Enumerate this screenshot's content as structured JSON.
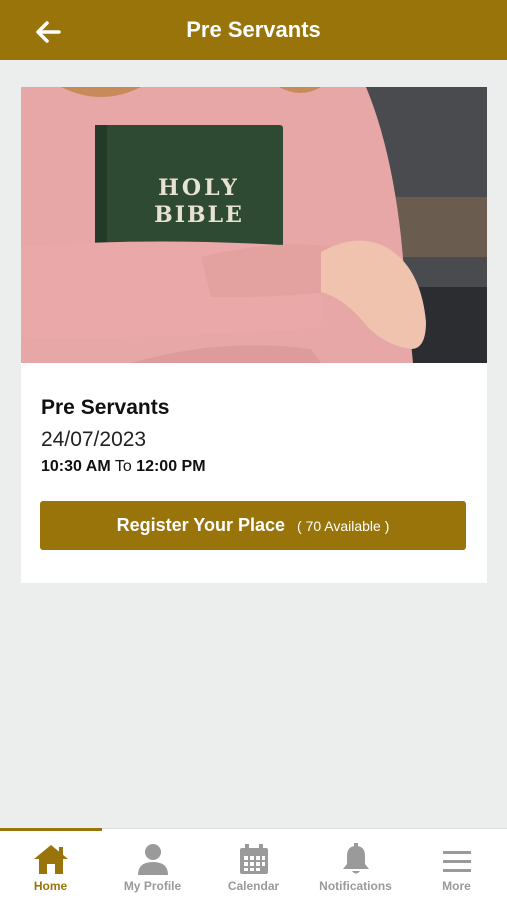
{
  "header": {
    "title": "Pre Servants",
    "back_icon": "arrow-left-icon"
  },
  "event": {
    "title": "Pre Servants",
    "date": "24/07/2023",
    "start_time": "10:30 AM",
    "time_separator": "To",
    "end_time": "12:00 PM",
    "register_label": "Register Your Place",
    "available": "( 70 Available )",
    "image_text_line1": "HOLY",
    "image_text_line2": "BIBLE"
  },
  "tabs": [
    {
      "label": "Home",
      "icon": "home-icon",
      "active": true
    },
    {
      "label": "My Profile",
      "icon": "user-icon",
      "active": false
    },
    {
      "label": "Calendar",
      "icon": "calendar-icon",
      "active": false
    },
    {
      "label": "Notifications",
      "icon": "bell-icon",
      "active": false
    },
    {
      "label": "More",
      "icon": "menu-icon",
      "active": false
    }
  ],
  "colors": {
    "accent": "#98740a",
    "background": "#eceeee",
    "inactive_tab": "#9a9a9a"
  }
}
